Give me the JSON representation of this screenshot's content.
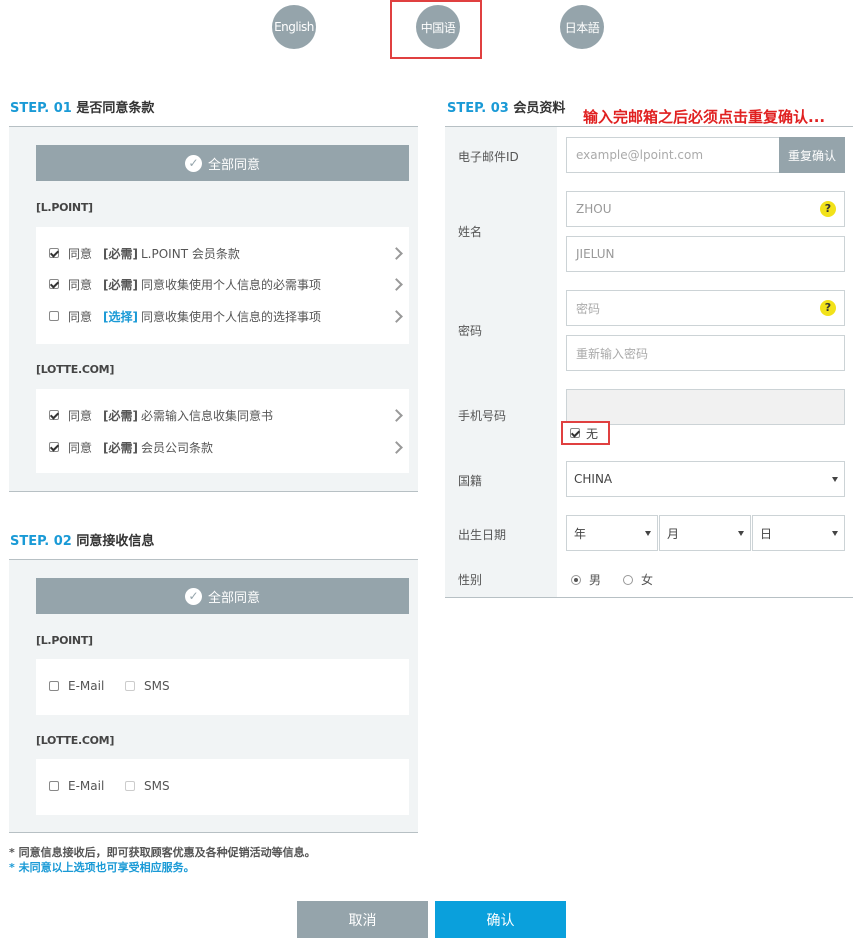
{
  "languages": [
    "English",
    "中国语",
    "日本語"
  ],
  "annotation": "输入完邮箱之后必须点击重复确认...",
  "step1": {
    "num": "STEP. 01",
    "title": "是否同意条款",
    "agree_all": "全部同意",
    "groups": [
      {
        "name": "[L.POINT]",
        "items": [
          {
            "agree": "同意",
            "tag": "[必需]",
            "text": "L.POINT 会员条款",
            "checked": true
          },
          {
            "agree": "同意",
            "tag": "[必需]",
            "text": "同意收集使用个人信息的必需事项",
            "checked": true
          },
          {
            "agree": "同意",
            "tag": "[选择]",
            "text": "同意收集使用个人信息的选择事项",
            "checked": false
          }
        ]
      },
      {
        "name": "[LOTTE.COM]",
        "items": [
          {
            "agree": "同意",
            "tag": "[必需]",
            "text": "必需输入信息收集同意书",
            "checked": true
          },
          {
            "agree": "同意",
            "tag": "[必需]",
            "text": "会员公司条款",
            "checked": true
          }
        ]
      }
    ]
  },
  "step2": {
    "num": "STEP. 02",
    "title": "同意接收信息",
    "agree_all": "全部同意",
    "groups": [
      {
        "name": "[L.POINT]",
        "email": "E-Mail",
        "sms": "SMS"
      },
      {
        "name": "[LOTTE.COM]",
        "email": "E-Mail",
        "sms": "SMS"
      }
    ],
    "note1": "* 同意信息接收后，即可获取顾客优惠及各种促销活动等信息。",
    "note2": "* 未同意以上选项也可享受相应服务。"
  },
  "step3": {
    "num": "STEP. 03",
    "title": "会员资料",
    "email_label": "电子邮件ID",
    "email_placeholder": "example@lpoint.com",
    "email_confirm": "重复确认",
    "name_label": "姓名",
    "last_name": "ZHOU",
    "first_name": "JIELUN",
    "password_label": "密码",
    "password_placeholder": "密码",
    "password_confirm_placeholder": "重新输入密码",
    "phone_label": "手机号码",
    "phone_none": "无",
    "nationality_label": "国籍",
    "nationality_value": "CHINA",
    "birth_label": "出生日期",
    "year": "年",
    "month": "月",
    "day": "日",
    "gender_label": "性别",
    "male": "男",
    "female": "女",
    "question_mark": "?"
  },
  "buttons": {
    "cancel": "取消",
    "confirm": "确认"
  }
}
